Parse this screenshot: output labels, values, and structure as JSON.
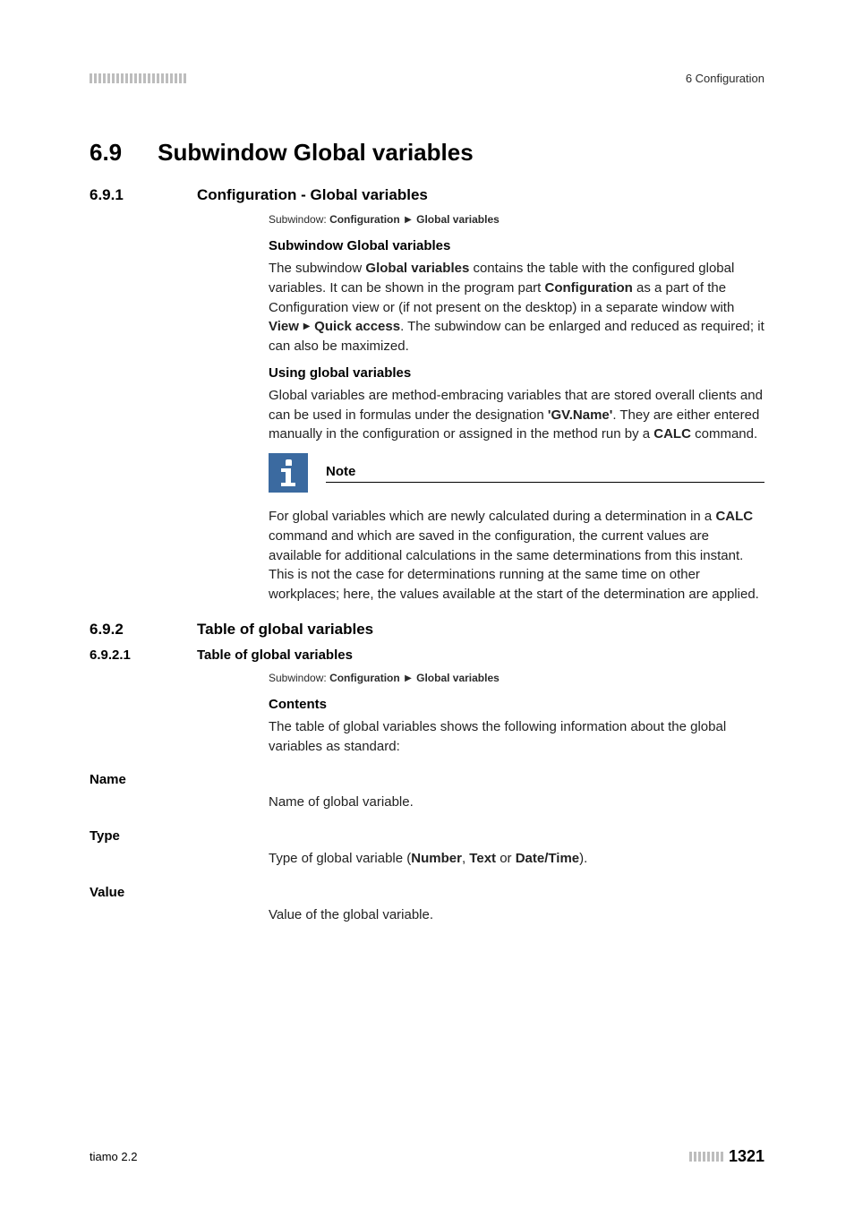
{
  "header": {
    "chapter": "6 Configuration"
  },
  "section69": {
    "num": "6.9",
    "title": "Subwindow Global variables"
  },
  "section691": {
    "num": "6.9.1",
    "title": "Configuration - Global variables",
    "breadcrumb_label": "Subwindow:",
    "breadcrumb_path1": "Configuration",
    "breadcrumb_path2": "Global variables",
    "sub1_title": "Subwindow Global variables",
    "sub1_p_a": "The subwindow ",
    "sub1_p_b": "Global variables",
    "sub1_p_c": " contains the table with the configured global variables. It can be shown in the program part ",
    "sub1_p_d": "Configuration",
    "sub1_p_e": " as a part of the Configuration view or (if not present on the desktop) in a separate window with ",
    "sub1_p_f": "View",
    "sub1_p_g": "Quick access",
    "sub1_p_h": ". The subwindow can be enlarged and reduced as required; it can also be maximized.",
    "sub2_title": "Using global variables",
    "sub2_p_a": "Global variables are method-embracing variables that are stored overall clients and can be used in formulas under the designation ",
    "sub2_p_b": "'GV.Name'",
    "sub2_p_c": ". They are either entered manually in the configuration or assigned in the method run by a ",
    "sub2_p_d": "CALC",
    "sub2_p_e": " command.",
    "note_title": "Note",
    "note_a": "For global variables which are newly calculated during a determination in a ",
    "note_b": "CALC",
    "note_c": " command and which are saved in the configuration, the current values are available for additional calculations in the same determinations from this instant. This is not the case for determinations running at the same time on other workplaces; here, the values available at the start of the determination are applied."
  },
  "section692": {
    "num": "6.9.2",
    "title": "Table of global variables"
  },
  "section6921": {
    "num": "6.9.2.1",
    "title": "Table of global variables",
    "breadcrumb_label": "Subwindow:",
    "breadcrumb_path1": "Configuration",
    "breadcrumb_path2": "Global variables",
    "contents_title": "Contents",
    "contents_p": "The table of global variables shows the following information about the global variables as standard:",
    "fields": {
      "name_label": "Name",
      "name_desc": "Name of global variable.",
      "type_label": "Type",
      "type_desc_a": "Type of global variable (",
      "type_desc_b": "Number",
      "type_desc_c": ", ",
      "type_desc_d": "Text",
      "type_desc_e": " or ",
      "type_desc_f": "Date/Time",
      "type_desc_g": ").",
      "value_label": "Value",
      "value_desc": "Value of the global variable."
    }
  },
  "footer": {
    "left": "tiamo 2.2",
    "page": "1321"
  }
}
